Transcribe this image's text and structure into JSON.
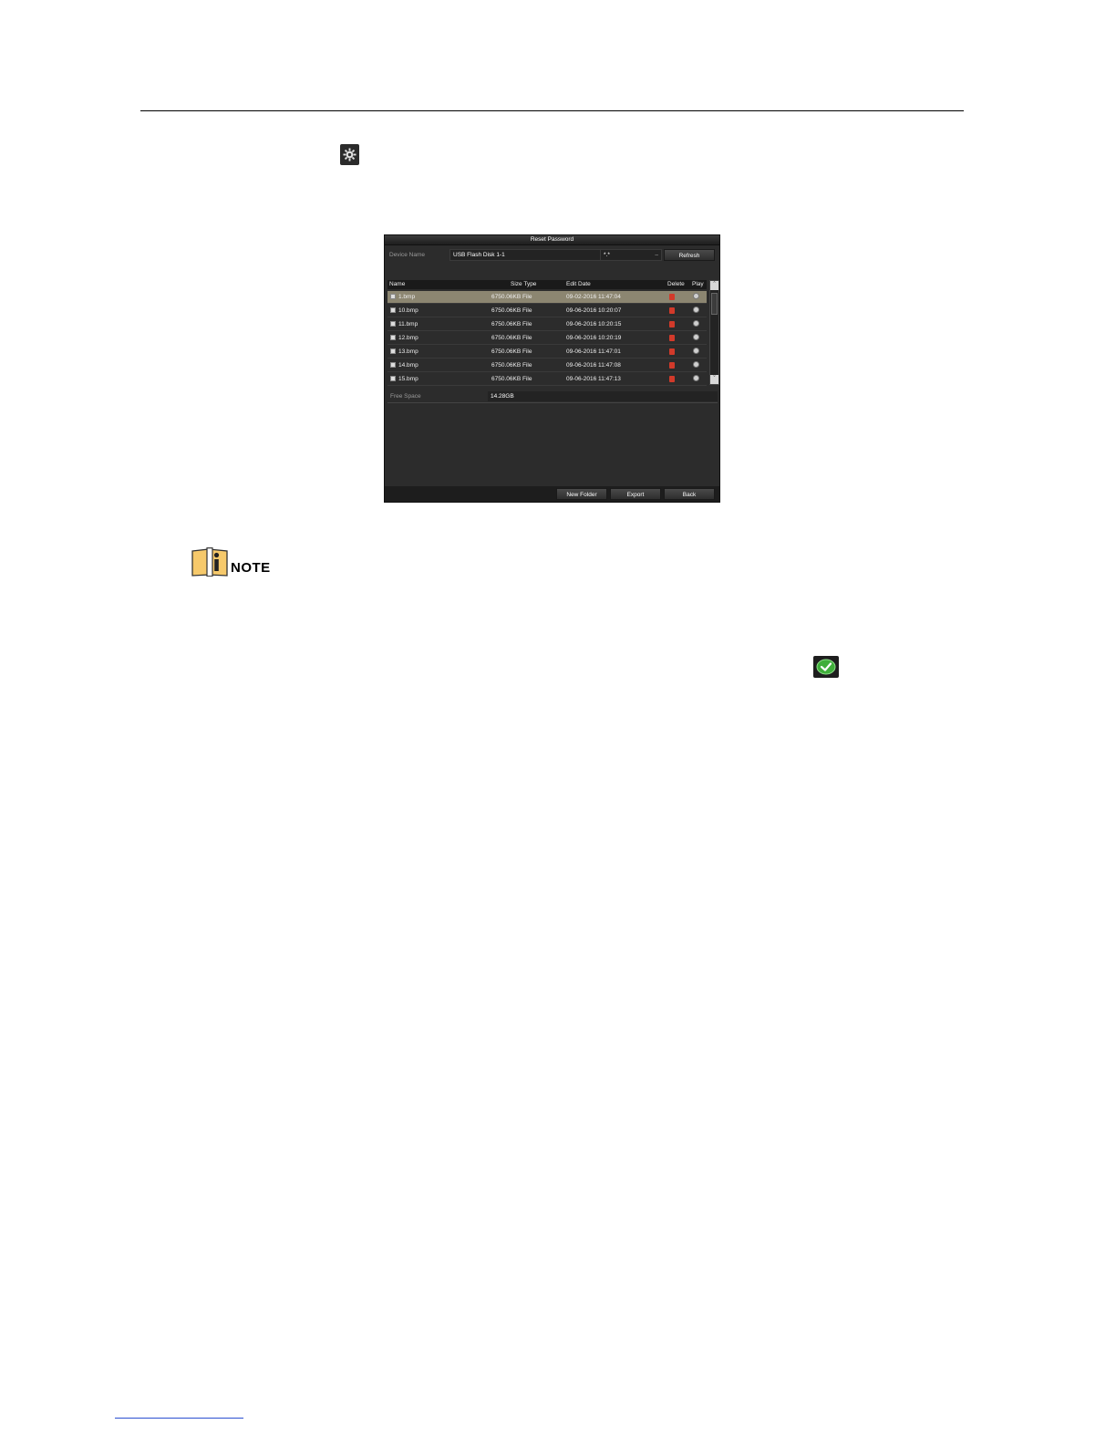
{
  "dialog": {
    "title": "Reset Password",
    "device_label": "Device Name",
    "device_value": "USB Flash Disk 1-1",
    "path_value": "*.*",
    "refresh_label": "Refresh",
    "columns": [
      "Name",
      "Size Type",
      "Edit Date",
      "Delete",
      "Play"
    ],
    "rows": [
      {
        "name": "1.bmp",
        "size": "6750.06KB File",
        "date": "09-02-2016 11:47:04",
        "selected": true
      },
      {
        "name": "10.bmp",
        "size": "6750.06KB File",
        "date": "09-06-2016 10:20:07"
      },
      {
        "name": "11.bmp",
        "size": "6750.06KB File",
        "date": "09-06-2016 10:20:15"
      },
      {
        "name": "12.bmp",
        "size": "6750.06KB File",
        "date": "09-06-2016 10:20:19"
      },
      {
        "name": "13.bmp",
        "size": "6750.06KB File",
        "date": "09-06-2016 11:47:01"
      },
      {
        "name": "14.bmp",
        "size": "6750.06KB File",
        "date": "09-06-2016 11:47:08"
      },
      {
        "name": "15.bmp",
        "size": "6750.06KB File",
        "date": "09-06-2016 11:47:13"
      }
    ],
    "free_space_label": "Free Space",
    "free_space_value": "14.28GB",
    "new_folder_label": "New Folder",
    "export_label": "Export",
    "back_label": "Back"
  },
  "note": {
    "label": "NOTE"
  },
  "icons": {
    "gear": "gear-icon",
    "check": "check-icon",
    "delete": "delete-icon",
    "play": "play-icon"
  },
  "colors": {
    "selected_row": "#8c8671",
    "dialog_bg": "#2c2c2c",
    "check_green": "#3fae3a"
  }
}
